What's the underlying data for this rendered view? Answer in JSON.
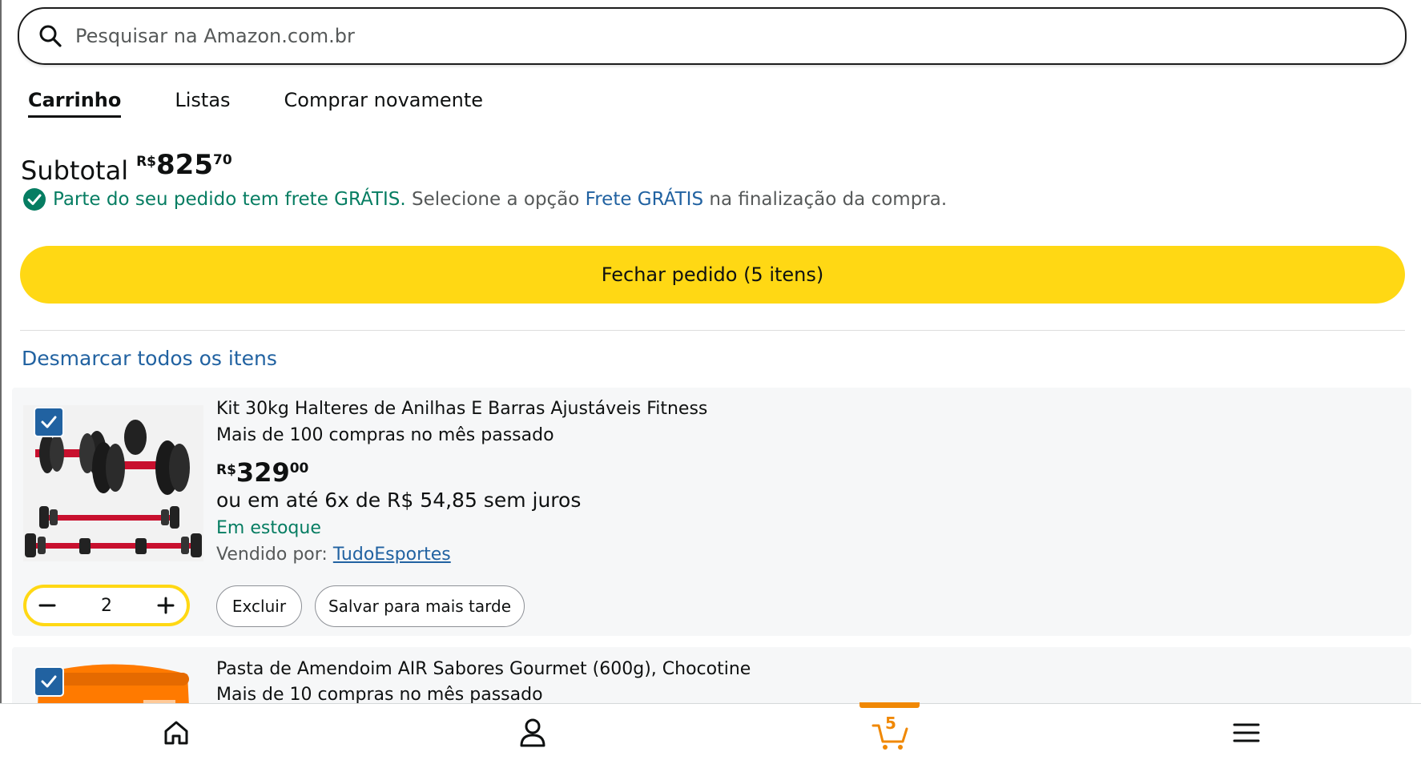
{
  "search": {
    "placeholder": "Pesquisar na Amazon.com.br"
  },
  "tabs": [
    {
      "label": "Carrinho",
      "active": true
    },
    {
      "label": "Listas",
      "active": false
    },
    {
      "label": "Comprar novamente",
      "active": false
    }
  ],
  "subtotal": {
    "label": "Subtotal",
    "currency": "R$",
    "integer": "825",
    "decimal": "70"
  },
  "freight": {
    "part1": "Parte do seu pedido tem frete GRÁTIS.",
    "part2": " Selecione a opção ",
    "part3": "Frete GRÁTIS",
    "part4": " na finalização da compra."
  },
  "checkout_label": "Fechar pedido (5 itens)",
  "deselect_label": "Desmarcar todos os itens",
  "items": [
    {
      "title": "Kit 30kg Halteres de Anilhas E Barras Ajustáveis Fitness",
      "purchases": "Mais de 100 compras no mês passado",
      "currency": "R$",
      "price_int": "329",
      "price_dec": "00",
      "installments": "ou em até 6x de R$ 54,85 sem juros",
      "stock": "Em estoque",
      "seller_label": "Vendido por: ",
      "seller_name": "TudoEsportes",
      "quantity": "2",
      "delete_label": "Excluir",
      "save_label": "Salvar para mais tarde",
      "checked": true
    },
    {
      "title": "Pasta de Amendoim AIR Sabores Gourmet (600g), Chocotine",
      "purchases": "Mais de 10 compras no mês passado",
      "checked": true
    }
  ],
  "nav": {
    "home_icon": "home-icon",
    "account_icon": "user-icon",
    "cart_icon": "cart-icon",
    "cart_count": "5",
    "menu_icon": "menu-icon"
  },
  "colors": {
    "accent_yellow": "#ffd814",
    "link_blue": "#2162a1",
    "success_green": "#067d62",
    "cart_orange": "#f08804"
  }
}
